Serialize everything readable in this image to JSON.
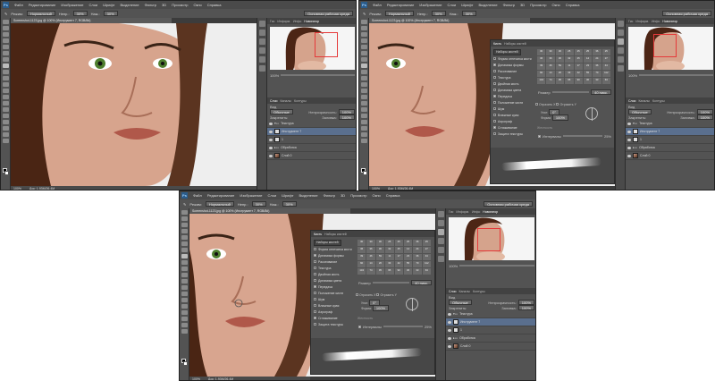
{
  "menu": {
    "logo": "Ps",
    "items": [
      "Файл",
      "Редактирование",
      "Изображение",
      "Слои",
      "Шрифт",
      "Выделение",
      "Фильтр",
      "3D",
      "Просмотр",
      "Окно",
      "Справка"
    ]
  },
  "options": {
    "mode_label": "Режим:",
    "mode_value": "Нормальный",
    "opacity_label": "Непр.:",
    "opacity_value": "30%",
    "flow_label": "Наж.:",
    "flow_value": "30%",
    "workspace": "Основная рабочая среда"
  },
  "document": {
    "tab": "Screenshot-1123.jpg @ 100% (Инструмент 7, RGB/8#)",
    "zoom": "100%",
    "doc_size": "Док: 1,93М/26,4М"
  },
  "panels": {
    "top_tabs": [
      "Гис",
      "Информ.",
      "Инфо",
      "Навигатор"
    ],
    "nav_zoom": "100%",
    "layer_tabs": [
      "Слои",
      "Каналы",
      "Контуры"
    ],
    "kind_label": "Вид",
    "blend_value": "Обычные",
    "opacity_label": "Непрозрачность:",
    "opacity_value": "100%",
    "lock_label": "Закрепить:",
    "fill_label": "Заливка:",
    "fill_value": "100%",
    "layers": [
      {
        "name": "Текстура",
        "type": "group",
        "selected": false
      },
      {
        "name": "Инструмент 7",
        "type": "layer",
        "selected": true
      },
      {
        "name": "1",
        "type": "layer",
        "selected": false
      },
      {
        "name": "Обработка",
        "type": "group",
        "selected": false
      },
      {
        "name": "Слой 0",
        "type": "image",
        "selected": false
      }
    ]
  },
  "brush_panel": {
    "tabs": [
      "Кисть",
      "Наборы кистей"
    ],
    "presets_button": "Наборы кистей",
    "options": [
      {
        "label": "Форма отпечатка кисти",
        "checked": false
      },
      {
        "label": "Динамика формы",
        "checked": true
      },
      {
        "label": "Рассеивание",
        "checked": false
      },
      {
        "label": "Текстура",
        "checked": false
      },
      {
        "label": "Двойная кисть",
        "checked": false
      },
      {
        "label": "Динамика цвета",
        "checked": false
      },
      {
        "label": "Передача",
        "checked": true
      },
      {
        "label": "Положение кисти",
        "checked": false
      },
      {
        "label": "Шум",
        "checked": false
      },
      {
        "label": "Влажные края",
        "checked": false
      },
      {
        "label": "Аэрограф",
        "checked": false
      },
      {
        "label": "Сглаживание",
        "checked": true
      },
      {
        "label": "Защита текстуры",
        "checked": false
      }
    ],
    "tips": [
      "30",
      "30",
      "30",
      "25",
      "25",
      "25",
      "36",
      "25",
      "36",
      "36",
      "36",
      "32",
      "25",
      "14",
      "24",
      "27",
      "39",
      "46",
      "59",
      "11",
      "17",
      "23",
      "36",
      "44",
      "60",
      "14",
      "26",
      "33",
      "42",
      "55",
      "70",
      "112",
      "134",
      "74",
      "95",
      "95",
      "90",
      "36",
      "33",
      "63"
    ],
    "size_label": "Размер",
    "size_value": "40 пикс.",
    "flip_x": "Отразить X",
    "flip_y": "Отразить Y",
    "angle_label": "Угол:",
    "angle_value": "0°",
    "roundness_label": "Форма:",
    "roundness_value": "100%",
    "hardness_label": "Жесткость",
    "spacing_label": "Интервалы",
    "spacing_value": "25%"
  },
  "colors": {
    "app_bg": "#3c3c3c",
    "panel_bg": "#535353",
    "selection": "#5a6f8e",
    "nav_frame": "#e53a3a"
  }
}
